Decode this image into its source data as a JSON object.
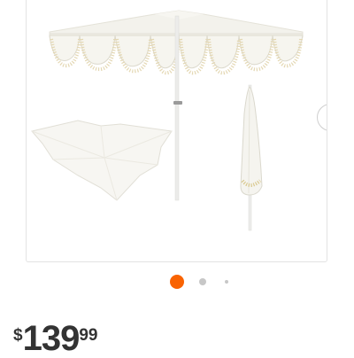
{
  "gallery": {
    "images": [
      {
        "icon": "umbrella-open-photo"
      },
      {
        "icon": "umbrella-top-view-photo"
      },
      {
        "icon": "umbrella-closed-photo"
      }
    ],
    "next_icon": "chevron-right-icon",
    "active_index": 0,
    "dot_count": 3,
    "colors": {
      "active_dot": "#f96302",
      "inactive_dot": "#c7c7c7",
      "chevron": "#f96302"
    }
  },
  "price": {
    "currency": "$",
    "dollars": "139",
    "cents": "99"
  }
}
